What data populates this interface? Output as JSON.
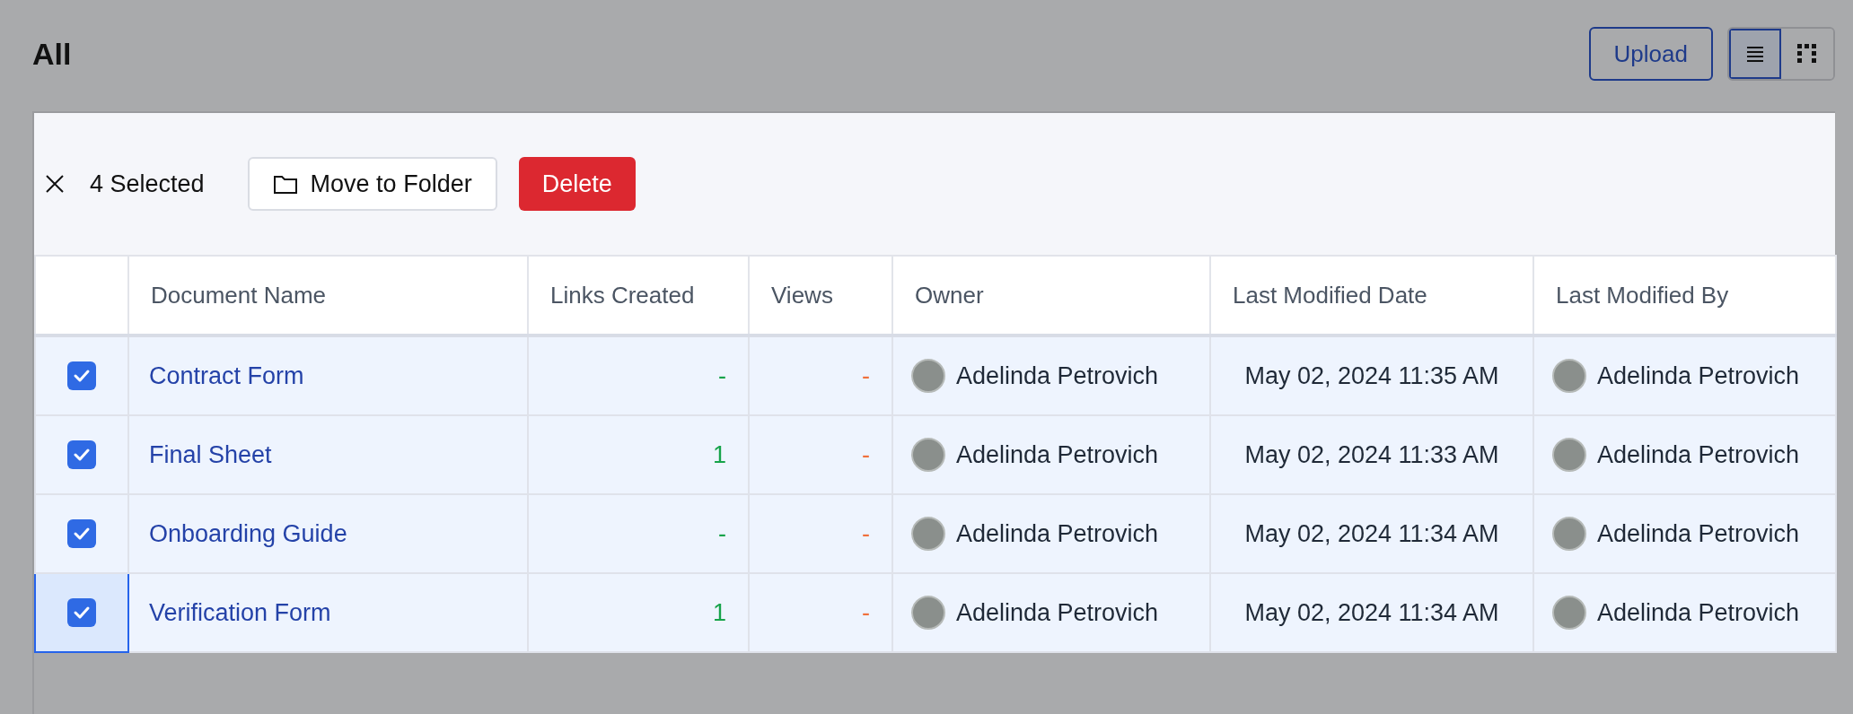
{
  "page": {
    "title": "All"
  },
  "actions": {
    "upload": "Upload",
    "views": [
      {
        "kind": "list",
        "selected": true
      },
      {
        "kind": "grid",
        "selected": false
      }
    ]
  },
  "selection_bar": {
    "count": "4 Selected",
    "move": "Move to Folder",
    "delete": "Delete"
  },
  "table": {
    "columns": [
      "Document Name",
      "Links Created",
      "Views",
      "Owner",
      "Last Modified Date",
      "Last Modified By"
    ],
    "rows": [
      {
        "checked": true,
        "focused": false,
        "name": "Contract Form",
        "links": "-",
        "views": "-",
        "owner": "Adelinda Petrovich",
        "date": "May 02, 2024 11:35 AM",
        "by": "Adelinda Petrovich"
      },
      {
        "checked": true,
        "focused": false,
        "name": "Final Sheet",
        "links": "1",
        "views": "-",
        "owner": "Adelinda Petrovich",
        "date": "May 02, 2024 11:33 AM",
        "by": "Adelinda Petrovich"
      },
      {
        "checked": true,
        "focused": false,
        "name": "Onboarding Guide",
        "links": "-",
        "views": "-",
        "owner": "Adelinda Petrovich",
        "date": "May 02, 2024 11:34 AM",
        "by": "Adelinda Petrovich"
      },
      {
        "checked": true,
        "focused": true,
        "name": "Verification Form",
        "links": "1",
        "views": "-",
        "owner": "Adelinda Petrovich",
        "date": "May 02, 2024 11:34 AM",
        "by": "Adelinda Petrovich"
      }
    ]
  }
}
